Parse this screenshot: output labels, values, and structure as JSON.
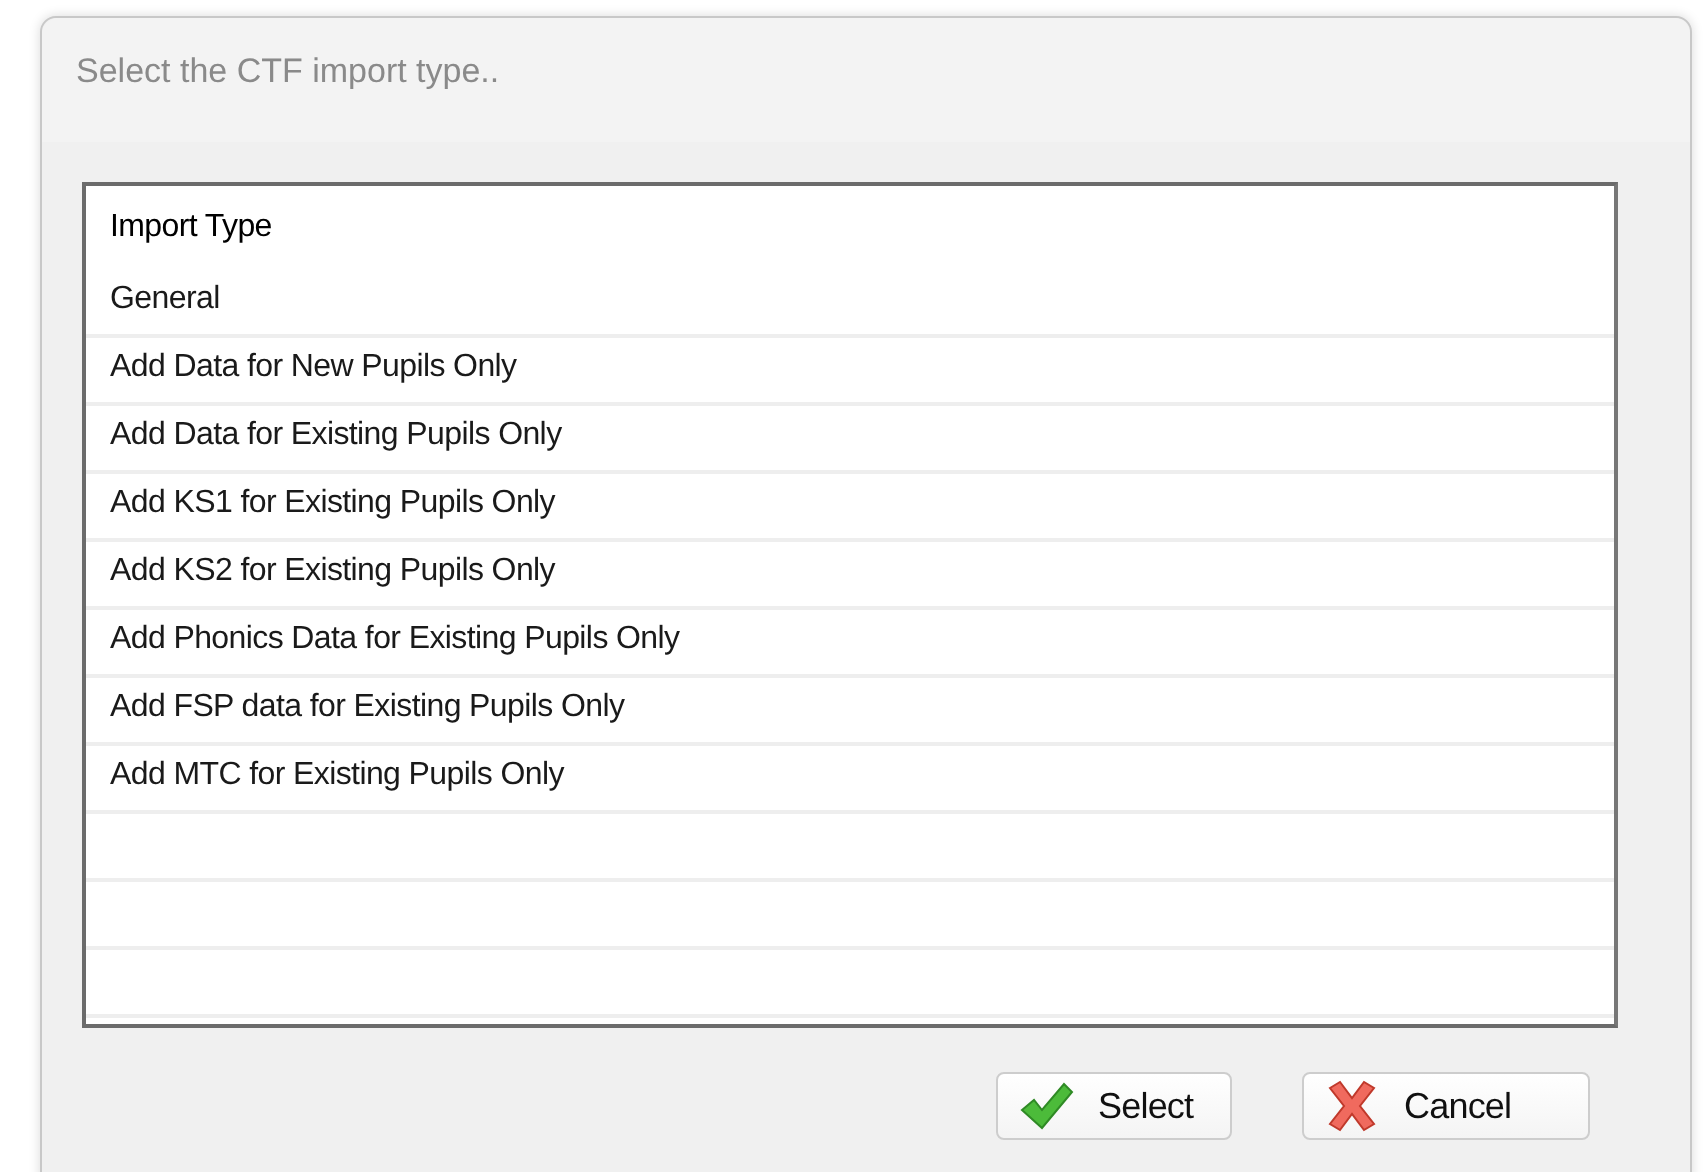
{
  "window": {
    "title": "Select the CTF import type.."
  },
  "list": {
    "column": "Import Type",
    "rows": [
      "General",
      "Add Data for New Pupils Only",
      "Add Data for Existing Pupils Only",
      "Add KS1 for Existing Pupils Only",
      "Add KS2 for Existing Pupils Only",
      "Add Phonics Data for Existing Pupils Only",
      "Add FSP data for Existing Pupils Only",
      "Add MTC for Existing Pupils Only"
    ]
  },
  "buttons": [
    {
      "kind": "ok",
      "label": "Select"
    },
    {
      "kind": "cancel",
      "label": "Cancel"
    }
  ]
}
